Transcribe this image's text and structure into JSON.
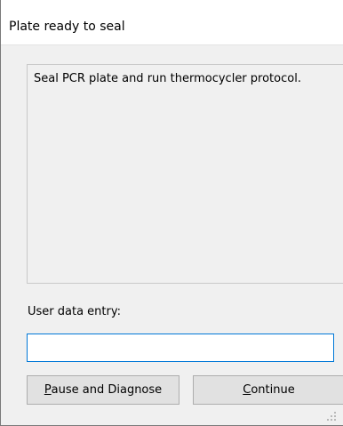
{
  "dialog": {
    "title": "Plate ready to seal",
    "message": "Seal PCR plate and run thermocycler protocol.",
    "entry_label": "User data entry:",
    "entry_value": "",
    "pause_button": {
      "mnemonic": "P",
      "rest": "ause and Diagnose"
    },
    "continue_button": {
      "mnemonic": "C",
      "rest": "ontinue"
    }
  },
  "colors": {
    "dialog_background": "#f0f0f0",
    "field_focus_border": "#0078d7",
    "button_face": "#e1e1e1"
  },
  "icons": [
    "resize-grip-icon"
  ]
}
